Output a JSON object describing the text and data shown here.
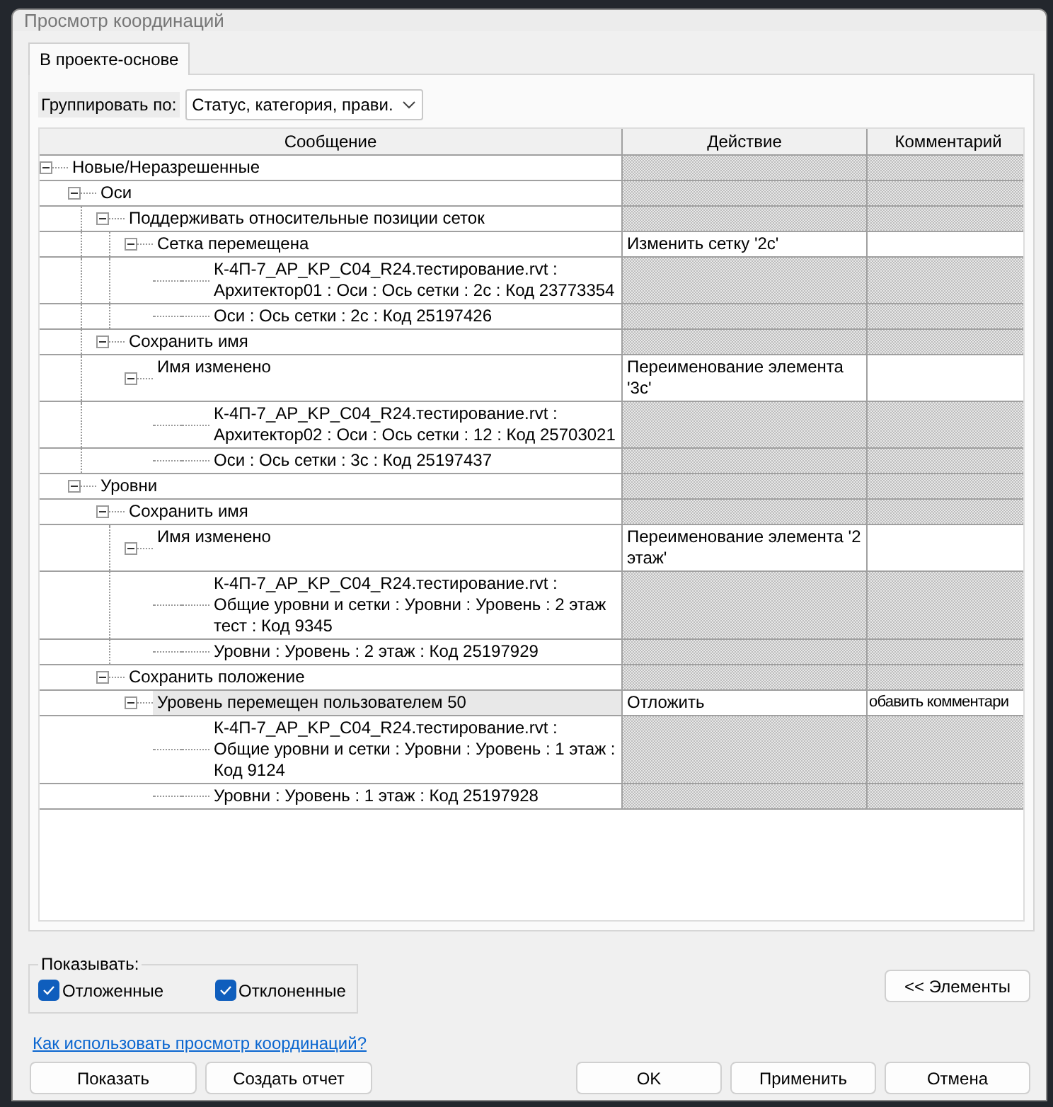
{
  "window": {
    "title": "Просмотр координаций"
  },
  "tabs": [
    {
      "label": "В проекте-основе",
      "selected": true
    }
  ],
  "group_by": {
    "label": "Группировать по:",
    "value": "Статус, категория, прави."
  },
  "table": {
    "columns": [
      "Сообщение",
      "Действие",
      "Комментарий"
    ],
    "tree": [
      {
        "kind": "group",
        "text": "Новые/Неразрешенные",
        "expanded": true,
        "children": [
          {
            "kind": "group",
            "text": "Оси",
            "expanded": true,
            "children": [
              {
                "kind": "group",
                "text": "Поддерживать относительные позиции сеток",
                "expanded": true,
                "children": [
                  {
                    "kind": "group",
                    "text": "Сетка перемещена",
                    "expanded": true,
                    "action": "Изменить сетку '2c'",
                    "selected": false,
                    "children": [
                      {
                        "kind": "element",
                        "text": "К-4П-7_AP_KP_C04_R24.тестирование.rvt : Архитектор01 : Оси : Ось сетки : 2c : Код 23773354"
                      },
                      {
                        "kind": "element",
                        "text": "Оси : Ось сетки : 2c : Код 25197426"
                      }
                    ]
                  }
                ]
              },
              {
                "kind": "group",
                "text": "Сохранить имя",
                "expanded": true,
                "children": [
                  {
                    "kind": "group",
                    "text": "Имя изменено",
                    "expanded": true,
                    "action": "Переименование элемента '3c'",
                    "selected": false,
                    "children": [
                      {
                        "kind": "element",
                        "text": "К-4П-7_AP_KP_C04_R24.тестирование.rvt : Архитектор02 : Оси : Ось сетки : 12 : Код 25703021"
                      },
                      {
                        "kind": "element",
                        "text": "Оси : Ось сетки : 3c : Код 25197437"
                      }
                    ]
                  }
                ]
              }
            ]
          },
          {
            "kind": "group",
            "text": "Уровни",
            "expanded": true,
            "children": [
              {
                "kind": "group",
                "text": "Сохранить имя",
                "expanded": true,
                "children": [
                  {
                    "kind": "group",
                    "text": "Имя изменено",
                    "expanded": true,
                    "action": "Переименование элемента '2 этаж'",
                    "selected": false,
                    "children": [
                      {
                        "kind": "element",
                        "text": "К-4П-7_AP_KP_C04_R24.тестирование.rvt : Общие уровни и сетки : Уровни : Уровень : 2 этаж тест : Код 9345"
                      },
                      {
                        "kind": "element",
                        "text": "Уровни : Уровень : 2 этаж : Код 25197929"
                      }
                    ]
                  }
                ]
              },
              {
                "kind": "group",
                "text": "Сохранить положение",
                "expanded": true,
                "children": [
                  {
                    "kind": "group",
                    "text": "Уровень перемещен пользователем 50",
                    "expanded": true,
                    "action": "Отложить",
                    "comment": "обавить комментари",
                    "selected": true,
                    "children": [
                      {
                        "kind": "element",
                        "text": "К-4П-7_AP_KP_C04_R24.тестирование.rvt : Общие уровни и сетки : Уровни : Уровень : 1 этаж : Код 9124"
                      },
                      {
                        "kind": "element",
                        "text": "Уровни : Уровень : 1 этаж : Код 25197928"
                      }
                    ]
                  }
                ]
              }
            ]
          }
        ]
      }
    ]
  },
  "show": {
    "legend": "Показывать:",
    "options": [
      {
        "label": "Отложенные",
        "checked": true
      },
      {
        "label": "Отклоненные",
        "checked": true
      }
    ]
  },
  "elements_button": "<< Элементы",
  "help_link": "Как использовать просмотр координаций?",
  "left_buttons": [
    "Показать",
    "Создать отчет"
  ],
  "right_buttons": [
    "OK",
    "Применить",
    "Отмена"
  ]
}
